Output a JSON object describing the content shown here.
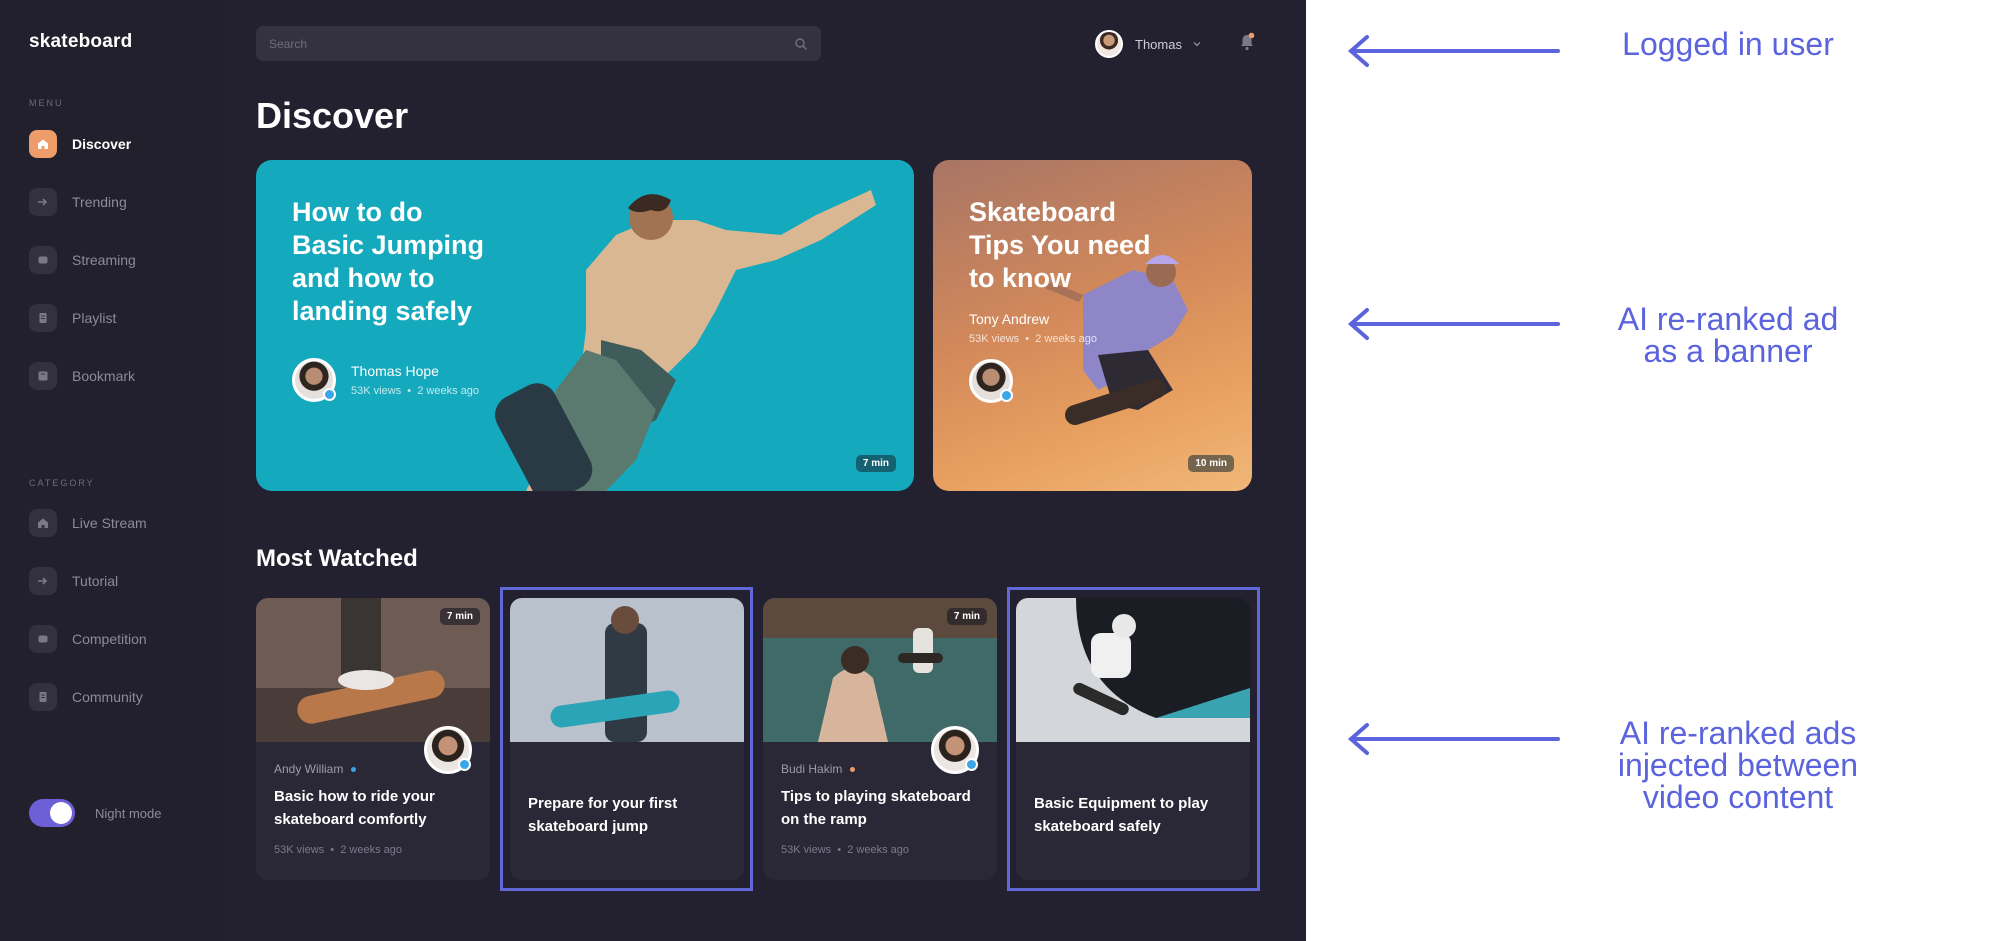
{
  "app": {
    "logo": "skateboard",
    "menu_label": "MENU",
    "category_label": "CATEGORY",
    "menu_items": [
      {
        "label": "Discover",
        "icon": "home-icon"
      },
      {
        "label": "Trending",
        "icon": "trending-icon"
      },
      {
        "label": "Streaming",
        "icon": "streaming-icon"
      },
      {
        "label": "Playlist",
        "icon": "playlist-icon"
      },
      {
        "label": "Bookmark",
        "icon": "bookmark-icon"
      }
    ],
    "category_items": [
      {
        "label": "Live Stream",
        "icon": "home-icon"
      },
      {
        "label": "Tutorial",
        "icon": "trending-icon"
      },
      {
        "label": "Competition",
        "icon": "streaming-icon"
      },
      {
        "label": "Community",
        "icon": "playlist-icon"
      }
    ],
    "night_mode_label": "Night mode",
    "night_mode_on": true,
    "accent": "#ee9c6a",
    "toggle_color": "#6d5fd6"
  },
  "topbar": {
    "search_placeholder": "Search",
    "user_name": "Thomas"
  },
  "page_title": "Discover",
  "banners": [
    {
      "title": "How to do\nBasic Jumping\nand how to\nlanding safely",
      "author": "Thomas Hope",
      "views": "53K views",
      "age": "2 weeks ago",
      "duration": "7 min",
      "background": "#15a9be"
    },
    {
      "title": "Skateboard\nTips You need\nto know",
      "author": "Tony Andrew",
      "views": "53K views",
      "age": "2 weeks ago",
      "duration": "10 min"
    }
  ],
  "most_watched": {
    "title": "Most Watched",
    "cards": [
      {
        "author": "Andy William",
        "dot_color": "#3aa6e8",
        "title": "Basic how to ride your skateboard comfortly",
        "views": "53K views",
        "age": "2 weeks ago",
        "duration": "7 min",
        "is_ad": false
      },
      {
        "author": "",
        "title": "Prepare for your first skateboard jump",
        "views": "",
        "age": "",
        "duration": "",
        "is_ad": true
      },
      {
        "author": "Budi Hakim",
        "dot_color": "#ee9c6a",
        "title": "Tips to playing skateboard on the ramp",
        "views": "53K views",
        "age": "2 weeks ago",
        "duration": "7 min",
        "is_ad": false
      },
      {
        "author": "",
        "title": "Basic Equipment to play skateboard safely",
        "views": "",
        "age": "",
        "duration": "",
        "is_ad": true
      }
    ]
  },
  "annotations": {
    "user": "Logged in user",
    "banner": "AI re-ranked ad\nas a banner",
    "injected": "AI re-ranked ads\ninjected between\nvideo content",
    "color": "#5b63dd"
  }
}
